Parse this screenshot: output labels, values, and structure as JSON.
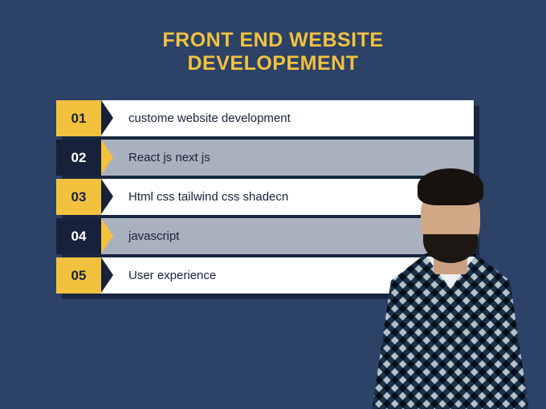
{
  "title_line1": "FRONT END WEBSITE",
  "title_line2": "DEVELOPEMENT",
  "items": [
    {
      "num": "01",
      "label": "custome website development",
      "style": "a"
    },
    {
      "num": "02",
      "label": "React js next js",
      "style": "b"
    },
    {
      "num": "03",
      "label": "Html css tailwind css shadecn",
      "style": "a"
    },
    {
      "num": "04",
      "label": "javascript",
      "style": "b"
    },
    {
      "num": "05",
      "label": "User experience",
      "style": "a"
    }
  ],
  "colors": {
    "bg": "#2d4267",
    "accent": "#f2c23f",
    "dark": "#17223a",
    "muted": "#a9b1bd",
    "white": "#ffffff"
  }
}
